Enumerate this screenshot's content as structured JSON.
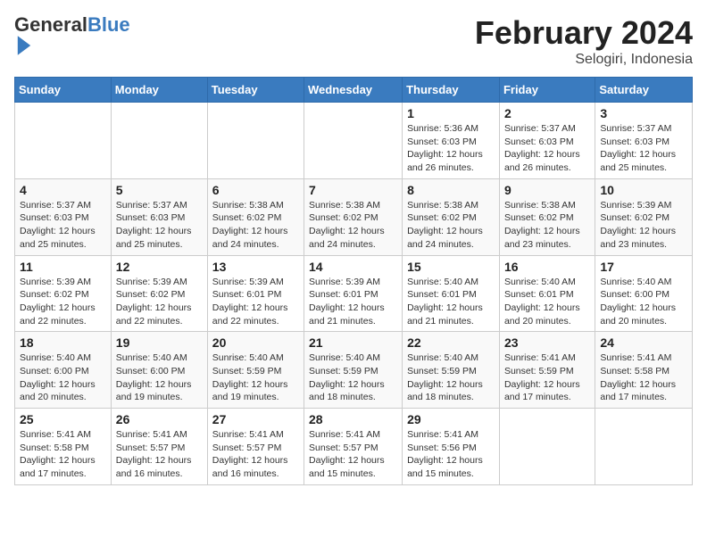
{
  "header": {
    "logo_general": "General",
    "logo_blue": "Blue",
    "month_title": "February 2024",
    "location": "Selogiri, Indonesia"
  },
  "columns": [
    "Sunday",
    "Monday",
    "Tuesday",
    "Wednesday",
    "Thursday",
    "Friday",
    "Saturday"
  ],
  "weeks": [
    [
      {
        "day": "",
        "info": ""
      },
      {
        "day": "",
        "info": ""
      },
      {
        "day": "",
        "info": ""
      },
      {
        "day": "",
        "info": ""
      },
      {
        "day": "1",
        "info": "Sunrise: 5:36 AM\nSunset: 6:03 PM\nDaylight: 12 hours\nand 26 minutes."
      },
      {
        "day": "2",
        "info": "Sunrise: 5:37 AM\nSunset: 6:03 PM\nDaylight: 12 hours\nand 26 minutes."
      },
      {
        "day": "3",
        "info": "Sunrise: 5:37 AM\nSunset: 6:03 PM\nDaylight: 12 hours\nand 25 minutes."
      }
    ],
    [
      {
        "day": "4",
        "info": "Sunrise: 5:37 AM\nSunset: 6:03 PM\nDaylight: 12 hours\nand 25 minutes."
      },
      {
        "day": "5",
        "info": "Sunrise: 5:37 AM\nSunset: 6:03 PM\nDaylight: 12 hours\nand 25 minutes."
      },
      {
        "day": "6",
        "info": "Sunrise: 5:38 AM\nSunset: 6:02 PM\nDaylight: 12 hours\nand 24 minutes."
      },
      {
        "day": "7",
        "info": "Sunrise: 5:38 AM\nSunset: 6:02 PM\nDaylight: 12 hours\nand 24 minutes."
      },
      {
        "day": "8",
        "info": "Sunrise: 5:38 AM\nSunset: 6:02 PM\nDaylight: 12 hours\nand 24 minutes."
      },
      {
        "day": "9",
        "info": "Sunrise: 5:38 AM\nSunset: 6:02 PM\nDaylight: 12 hours\nand 23 minutes."
      },
      {
        "day": "10",
        "info": "Sunrise: 5:39 AM\nSunset: 6:02 PM\nDaylight: 12 hours\nand 23 minutes."
      }
    ],
    [
      {
        "day": "11",
        "info": "Sunrise: 5:39 AM\nSunset: 6:02 PM\nDaylight: 12 hours\nand 22 minutes."
      },
      {
        "day": "12",
        "info": "Sunrise: 5:39 AM\nSunset: 6:02 PM\nDaylight: 12 hours\nand 22 minutes."
      },
      {
        "day": "13",
        "info": "Sunrise: 5:39 AM\nSunset: 6:01 PM\nDaylight: 12 hours\nand 22 minutes."
      },
      {
        "day": "14",
        "info": "Sunrise: 5:39 AM\nSunset: 6:01 PM\nDaylight: 12 hours\nand 21 minutes."
      },
      {
        "day": "15",
        "info": "Sunrise: 5:40 AM\nSunset: 6:01 PM\nDaylight: 12 hours\nand 21 minutes."
      },
      {
        "day": "16",
        "info": "Sunrise: 5:40 AM\nSunset: 6:01 PM\nDaylight: 12 hours\nand 20 minutes."
      },
      {
        "day": "17",
        "info": "Sunrise: 5:40 AM\nSunset: 6:00 PM\nDaylight: 12 hours\nand 20 minutes."
      }
    ],
    [
      {
        "day": "18",
        "info": "Sunrise: 5:40 AM\nSunset: 6:00 PM\nDaylight: 12 hours\nand 20 minutes."
      },
      {
        "day": "19",
        "info": "Sunrise: 5:40 AM\nSunset: 6:00 PM\nDaylight: 12 hours\nand 19 minutes."
      },
      {
        "day": "20",
        "info": "Sunrise: 5:40 AM\nSunset: 5:59 PM\nDaylight: 12 hours\nand 19 minutes."
      },
      {
        "day": "21",
        "info": "Sunrise: 5:40 AM\nSunset: 5:59 PM\nDaylight: 12 hours\nand 18 minutes."
      },
      {
        "day": "22",
        "info": "Sunrise: 5:40 AM\nSunset: 5:59 PM\nDaylight: 12 hours\nand 18 minutes."
      },
      {
        "day": "23",
        "info": "Sunrise: 5:41 AM\nSunset: 5:59 PM\nDaylight: 12 hours\nand 17 minutes."
      },
      {
        "day": "24",
        "info": "Sunrise: 5:41 AM\nSunset: 5:58 PM\nDaylight: 12 hours\nand 17 minutes."
      }
    ],
    [
      {
        "day": "25",
        "info": "Sunrise: 5:41 AM\nSunset: 5:58 PM\nDaylight: 12 hours\nand 17 minutes."
      },
      {
        "day": "26",
        "info": "Sunrise: 5:41 AM\nSunset: 5:57 PM\nDaylight: 12 hours\nand 16 minutes."
      },
      {
        "day": "27",
        "info": "Sunrise: 5:41 AM\nSunset: 5:57 PM\nDaylight: 12 hours\nand 16 minutes."
      },
      {
        "day": "28",
        "info": "Sunrise: 5:41 AM\nSunset: 5:57 PM\nDaylight: 12 hours\nand 15 minutes."
      },
      {
        "day": "29",
        "info": "Sunrise: 5:41 AM\nSunset: 5:56 PM\nDaylight: 12 hours\nand 15 minutes."
      },
      {
        "day": "",
        "info": ""
      },
      {
        "day": "",
        "info": ""
      }
    ]
  ]
}
